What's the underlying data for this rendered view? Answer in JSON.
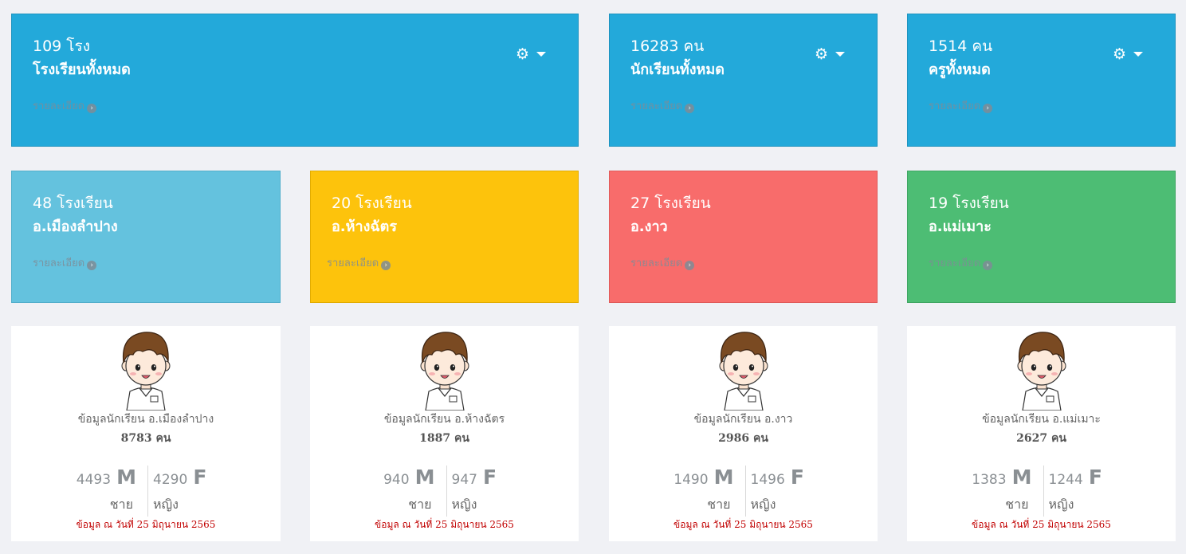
{
  "summary": [
    {
      "title": "109 โรง",
      "subtitle": "โรงเรียนทั้งหมด",
      "link": "รายละเอียด"
    },
    {
      "title": "16283 คน",
      "subtitle": "นักเรียนทั้งหมด",
      "link": "รายละเอียด"
    },
    {
      "title": "1514 คน",
      "subtitle": "ครูทั้งหมด",
      "link": "รายละเอียด"
    }
  ],
  "districts": [
    {
      "title": "48 โรงเรียน",
      "subtitle": "อ.เมืองลำปาง",
      "link": "รายละเอียด",
      "color": "#64c2de"
    },
    {
      "title": "20 โรงเรียน",
      "subtitle": "อ.ห้างฉัตร",
      "link": "รายละเอียด",
      "color": "#fdc30c"
    },
    {
      "title": "27 โรงเรียน",
      "subtitle": "อ.งาว",
      "link": "รายละเอียด",
      "color": "#f86c6b"
    },
    {
      "title": "19 โรงเรียน",
      "subtitle": "อ.แม่เมาะ",
      "link": "รายละเอียด",
      "color": "#4dbd74"
    }
  ],
  "students": [
    {
      "label": "ข้อมูลนักเรียน อ.เมืองลำปาง",
      "total": "8783 คน",
      "male": "4493",
      "female": "4290",
      "m": "M",
      "f": "F",
      "male_th": "ชาย",
      "female_th": "หญิง",
      "date": "ข้อมูล ณ วันที่ 25 มิถุนายน 2565"
    },
    {
      "label": "ข้อมูลนักเรียน อ.ห้างฉัตร",
      "total": "1887 คน",
      "male": "940",
      "female": "947",
      "m": "M",
      "f": "F",
      "male_th": "ชาย",
      "female_th": "หญิง",
      "date": "ข้อมูล ณ วันที่ 25 มิถุนายน 2565"
    },
    {
      "label": "ข้อมูลนักเรียน อ.งาว",
      "total": "2986 คน",
      "male": "1490",
      "female": "1496",
      "m": "M",
      "f": "F",
      "male_th": "ชาย",
      "female_th": "หญิง",
      "date": "ข้อมูล ณ วันที่ 25 มิถุนายน 2565"
    },
    {
      "label": "ข้อมูลนักเรียน อ.แม่เมาะ",
      "total": "2627 คน",
      "male": "1383",
      "female": "1244",
      "m": "M",
      "f": "F",
      "male_th": "ชาย",
      "female_th": "หญิง",
      "date": "ข้อมูล ณ วันที่ 25 มิถุนายน 2565"
    }
  ],
  "icons": {
    "settings": "gear-icon",
    "dropdown": "caret-down-icon",
    "details": "arrow-circle-right-icon",
    "avatar": "student-boy-avatar"
  }
}
